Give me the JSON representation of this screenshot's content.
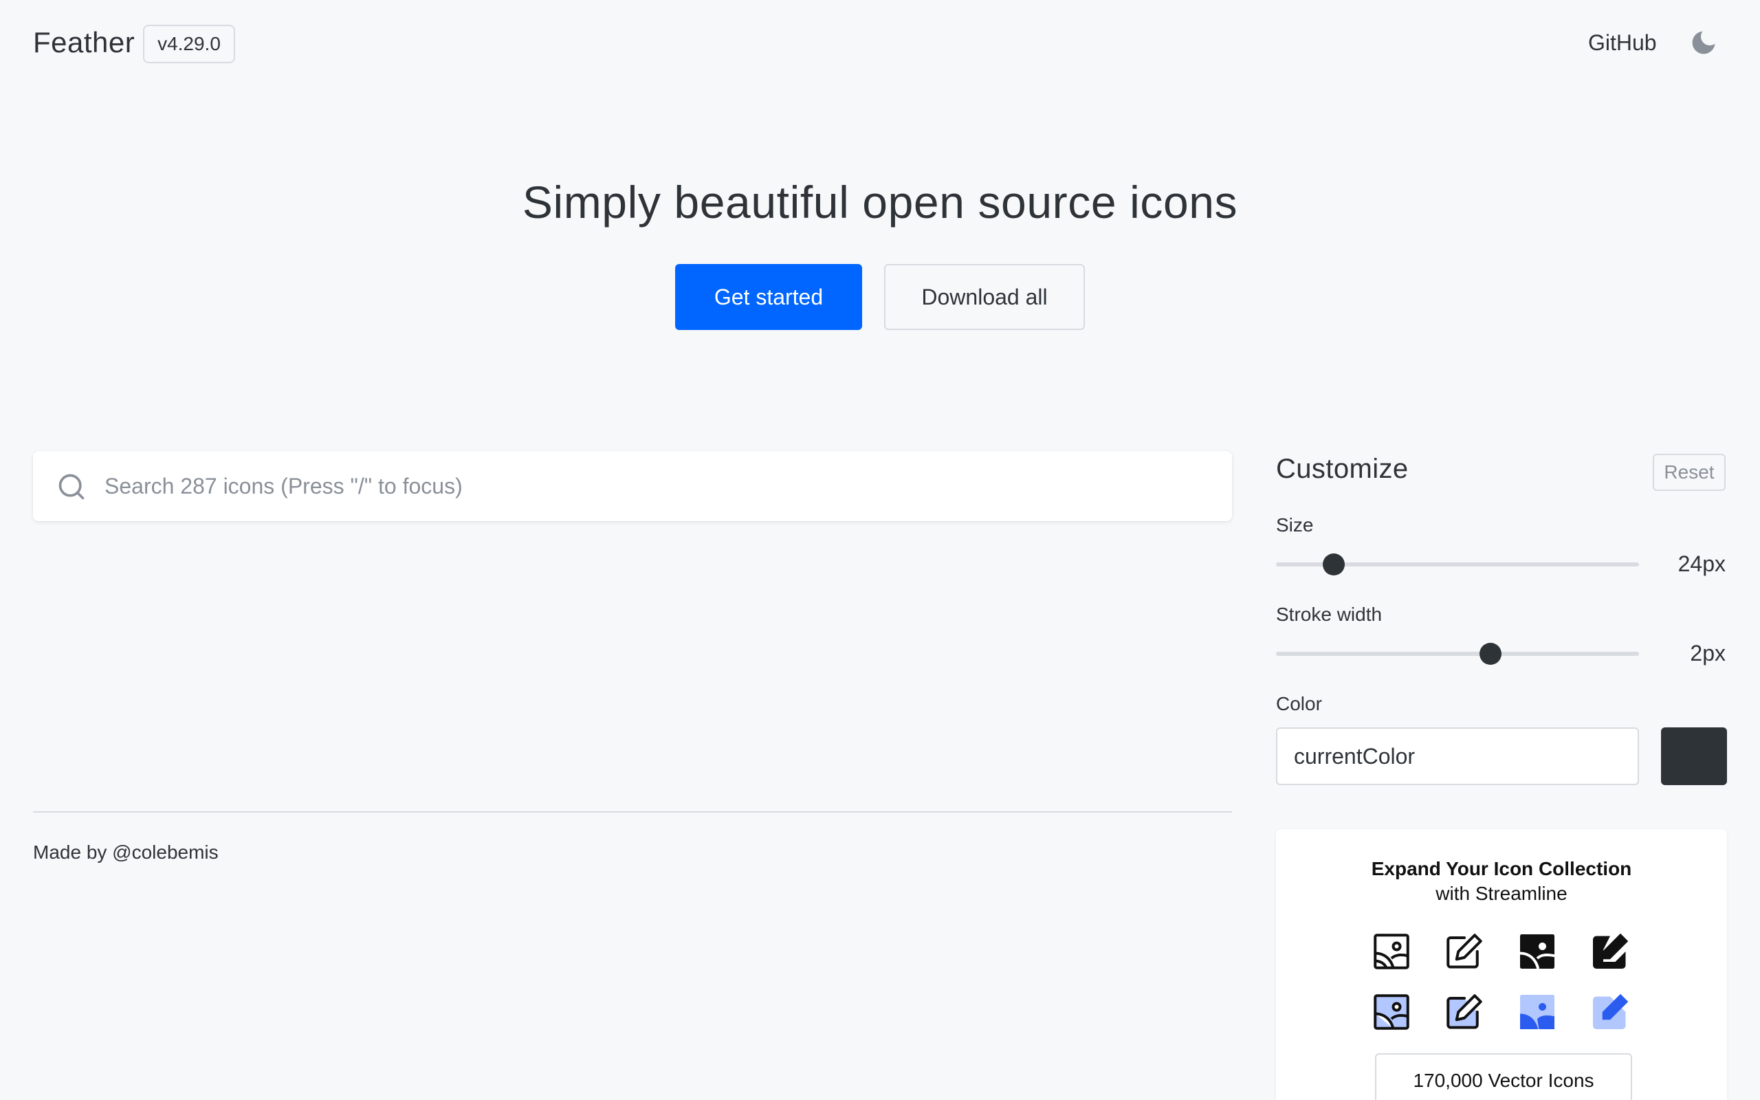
{
  "header": {
    "logo": "Feather",
    "version": "v4.29.0",
    "github_label": "GitHub",
    "theme_icon": "moon-icon"
  },
  "hero": {
    "title": "Simply beautiful open source icons",
    "primary_button": "Get started",
    "secondary_button": "Download all"
  },
  "search": {
    "placeholder": "Search 287 icons (Press \"/\" to focus)",
    "icon": "search-icon"
  },
  "footer": {
    "credit": "Made by @colebemis"
  },
  "customize": {
    "title": "Customize",
    "reset_label": "Reset",
    "size": {
      "label": "Size",
      "value_text": "24px",
      "fraction": 0.16
    },
    "stroke": {
      "label": "Stroke width",
      "value_text": "2px",
      "fraction": 0.59
    },
    "color": {
      "label": "Color",
      "value": "currentColor",
      "swatch": "#2e3338"
    }
  },
  "ad": {
    "title": "Expand Your Icon Collection",
    "subtitle": "with Streamline",
    "cta": "170,000 Vector Icons",
    "icons": [
      "image-outline-icon",
      "edit-outline-icon",
      "image-solid-icon",
      "edit-solid-icon",
      "image-duo-icon",
      "edit-duo-icon",
      "image-flat-icon",
      "edit-flat-icon"
    ]
  },
  "colors": {
    "primary": "#0066ff",
    "text": "#2e3338",
    "background": "#f7f8fa",
    "border": "#d8dbdf",
    "accent_light": "#b3c7ff",
    "accent": "#2b5cf0"
  }
}
